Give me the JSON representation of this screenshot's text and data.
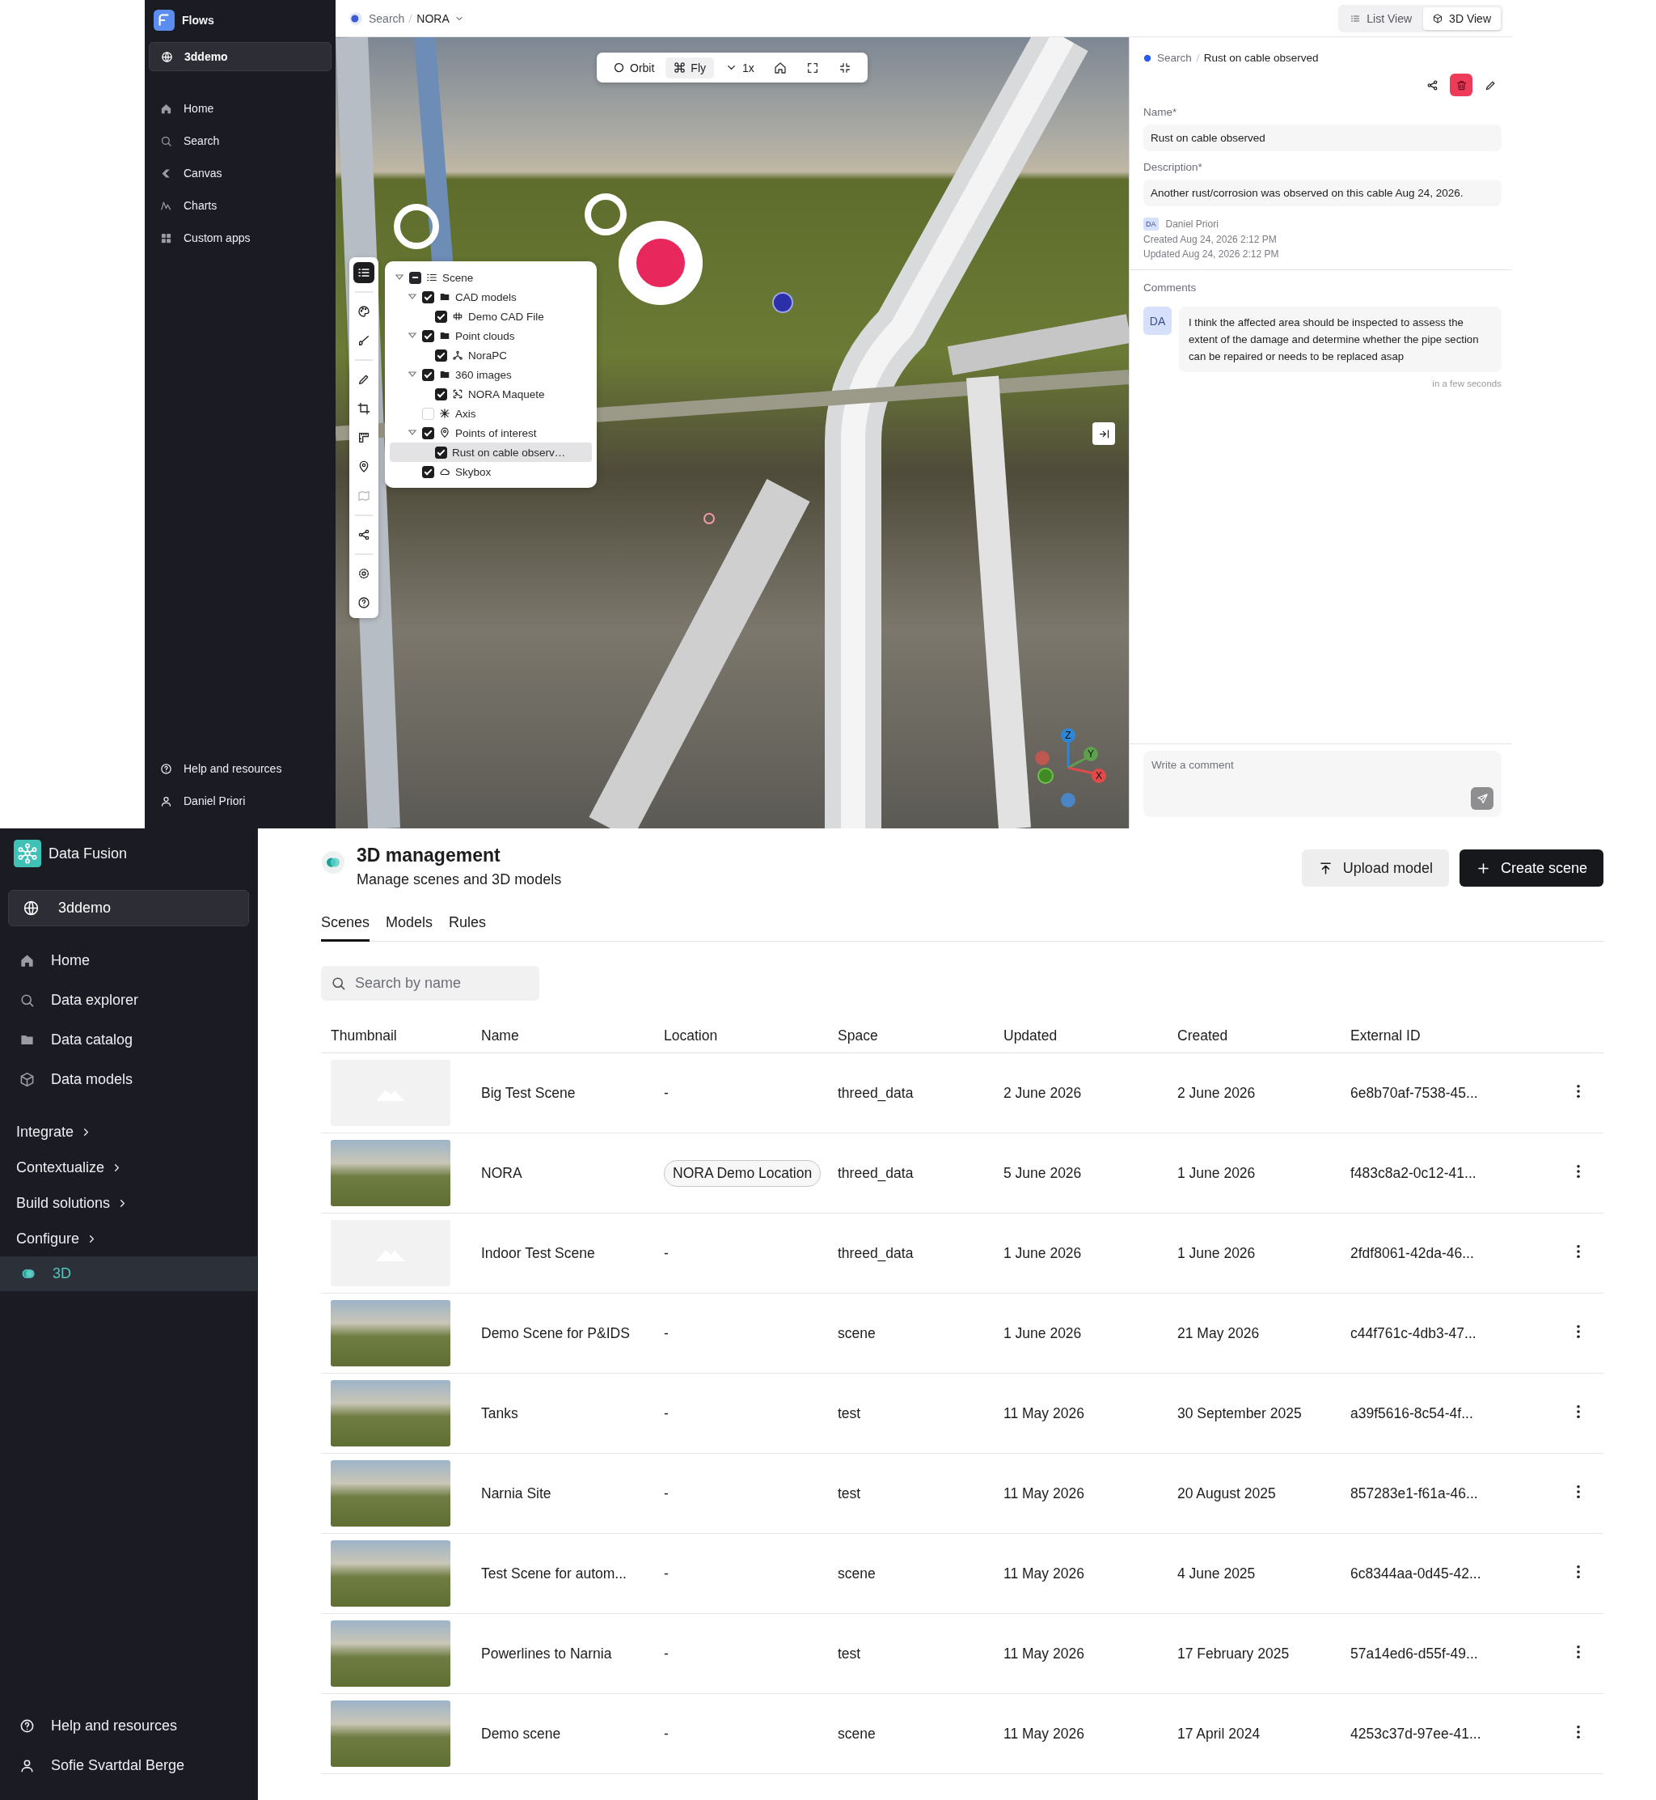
{
  "flows_app": {
    "sidebar": {
      "app_name": "Flows",
      "project": "3ddemo",
      "items": [
        {
          "label": "Home",
          "kind": "home"
        },
        {
          "label": "Search",
          "kind": "search"
        },
        {
          "label": "Canvas",
          "kind": "shape"
        },
        {
          "label": "Charts",
          "kind": "chart"
        },
        {
          "label": "Custom apps",
          "kind": "grid"
        }
      ],
      "footer": [
        {
          "label": "Help and resources",
          "kind": "help"
        },
        {
          "label": "Daniel Priori",
          "kind": "user"
        }
      ]
    },
    "header": {
      "breadcrumb": [
        "Search",
        "NORA"
      ],
      "views": [
        {
          "label": "List View",
          "kind": "list",
          "selected": false
        },
        {
          "label": "3D View",
          "kind": "cube",
          "selected": true
        }
      ]
    },
    "viewer": {
      "modes": [
        {
          "label": "Orbit",
          "kind": "circle",
          "selected": false
        },
        {
          "label": "Fly",
          "kind": "command",
          "selected": true
        }
      ],
      "speed": "1x",
      "tool_groups": [
        [
          {
            "kind": "list",
            "selected": true,
            "disabled": false
          }
        ],
        [
          {
            "kind": "palette",
            "selected": false,
            "disabled": false
          },
          {
            "kind": "brush",
            "selected": false,
            "disabled": false
          }
        ],
        [
          {
            "kind": "pencil",
            "selected": false,
            "disabled": false
          },
          {
            "kind": "crop",
            "selected": false,
            "disabled": false
          },
          {
            "kind": "ruler",
            "selected": false,
            "disabled": false
          },
          {
            "kind": "pin",
            "selected": false,
            "disabled": false
          },
          {
            "kind": "map",
            "selected": false,
            "disabled": true
          }
        ],
        [
          {
            "kind": "share",
            "selected": false,
            "disabled": false
          }
        ],
        [
          {
            "kind": "gear",
            "selected": false,
            "disabled": false
          },
          {
            "kind": "help",
            "selected": false,
            "disabled": false
          }
        ]
      ],
      "scene_tree": [
        {
          "label": "Scene",
          "kind": "list",
          "checked": false,
          "mixed": true,
          "selected": false,
          "expanded": true,
          "children": [
            {
              "label": "CAD models",
              "kind": "folder",
              "checked": true,
              "selected": false,
              "expanded": true,
              "children": [
                {
                  "label": "Demo CAD File",
                  "kind": "cad",
                  "checked": true,
                  "selected": false
                }
              ]
            },
            {
              "label": "Point clouds",
              "kind": "folder",
              "checked": true,
              "selected": false,
              "expanded": true,
              "children": [
                {
                  "label": "NoraPC",
                  "kind": "pointcloud",
                  "checked": true,
                  "selected": false
                }
              ]
            },
            {
              "label": "360 images",
              "kind": "folder",
              "checked": true,
              "selected": false,
              "expanded": true,
              "children": [
                {
                  "label": "NORA Maquete",
                  "kind": "image360",
                  "checked": true,
                  "selected": false
                }
              ]
            },
            {
              "label": "Axis",
              "kind": "axis",
              "checked": false,
              "selected": false
            },
            {
              "label": "Points of interest",
              "kind": "pin",
              "checked": true,
              "selected": false,
              "expanded": true,
              "children": [
                {
                  "label": "Rust on cable observ…",
                  "kind": "plain",
                  "checked": true,
                  "selected": true
                }
              ]
            },
            {
              "label": "Skybox",
              "kind": "cloud",
              "checked": true,
              "selected": false
            }
          ]
        }
      ],
      "axis_labels": [
        "Z",
        "Y",
        "X"
      ]
    },
    "detail_panel": {
      "breadcrumb": [
        "Search",
        "Rust on cable observed"
      ],
      "actions": [
        {
          "kind": "share"
        },
        {
          "kind": "delete"
        },
        {
          "kind": "edit"
        }
      ],
      "fields": [
        {
          "label": "Name*",
          "value": "Rust on cable observed"
        },
        {
          "label": "Description*",
          "value": "Another rust/corrosion was observed on this cable Aug 24, 2026."
        }
      ],
      "author": {
        "initials": "DA",
        "name": "Daniel Priori"
      },
      "created": "Created Aug 24, 2026 2:12 PM",
      "updated": "Updated Aug 24, 2026 2:12 PM",
      "comments_title": "Comments",
      "comments": [
        {
          "initials": "DA",
          "text": "I think the affected area should be inspected to assess the extent of the damage and determine whether the pipe section can be repaired or needs to be replaced asap",
          "time": "in a few seconds"
        }
      ],
      "comment_input": {
        "placeholder": "Write a comment"
      }
    }
  },
  "data_fusion_app": {
    "sidebar": {
      "app_name": "Data Fusion",
      "project": "3ddemo",
      "items": [
        {
          "label": "Home",
          "kind": "home"
        },
        {
          "label": "Data explorer",
          "kind": "search"
        },
        {
          "label": "Data catalog",
          "kind": "folder"
        },
        {
          "label": "Data models",
          "kind": "cube"
        }
      ],
      "nav": [
        {
          "label": "Integrate",
          "kind": "group",
          "selected": false
        },
        {
          "label": "Contextualize",
          "kind": "group",
          "selected": false
        },
        {
          "label": "Build solutions",
          "kind": "group",
          "selected": false
        },
        {
          "label": "Configure",
          "kind": "group",
          "selected": false
        },
        {
          "label": "3D",
          "kind": "link",
          "selected": true
        }
      ],
      "footer": [
        {
          "label": "Help and resources",
          "kind": "help"
        },
        {
          "label": "Sofie Svartdal Berge",
          "kind": "user"
        }
      ]
    },
    "page": {
      "title": "3D management",
      "subtitle": "Manage scenes and 3D models",
      "buttons": [
        {
          "label": "Upload model",
          "kind": "secondary"
        },
        {
          "label": "Create scene",
          "kind": "primary"
        }
      ],
      "tabs": [
        {
          "label": "Scenes",
          "selected": true
        },
        {
          "label": "Models",
          "selected": false
        },
        {
          "label": "Rules",
          "selected": false
        }
      ],
      "search": {
        "placeholder": "Search by name"
      },
      "table": {
        "columns": [
          "Thumbnail",
          "Name",
          "Location",
          "Space",
          "Updated",
          "Created",
          "External ID"
        ],
        "rows": [
          {
            "thumbnail": {
              "kind": "blank"
            },
            "name": "Big Test Scene",
            "location": {
              "text": "-",
              "kind": "plain"
            },
            "space": "threed_data",
            "updated": "2 June 2026",
            "created": "2 June 2026",
            "external_id": "6e8b70af-7538-45..."
          },
          {
            "thumbnail": {
              "kind": "photo"
            },
            "name": "NORA",
            "location": {
              "text": "NORA Demo Location",
              "kind": "chip"
            },
            "space": "threed_data",
            "updated": "5 June 2026",
            "created": "1 June 2026",
            "external_id": "f483c8a2-0c12-41..."
          },
          {
            "thumbnail": {
              "kind": "blank"
            },
            "name": "Indoor Test Scene",
            "location": {
              "text": "-",
              "kind": "plain"
            },
            "space": "threed_data",
            "updated": "1 June 2026",
            "created": "1 June 2026",
            "external_id": "2fdf8061-42da-46..."
          },
          {
            "thumbnail": {
              "kind": "photo"
            },
            "name": "Demo Scene for P&IDS",
            "location": {
              "text": "-",
              "kind": "plain"
            },
            "space": "scene",
            "updated": "1 June 2026",
            "created": "21 May 2026",
            "external_id": "c44f761c-4db3-47..."
          },
          {
            "thumbnail": {
              "kind": "photo"
            },
            "name": "Tanks",
            "location": {
              "text": "-",
              "kind": "plain"
            },
            "space": "test",
            "updated": "11 May 2026",
            "created": "30 September 2025",
            "external_id": "a39f5616-8c54-4f..."
          },
          {
            "thumbnail": {
              "kind": "photo"
            },
            "name": "Narnia Site",
            "location": {
              "text": "-",
              "kind": "plain"
            },
            "space": "test",
            "updated": "11 May 2026",
            "created": "20 August 2025",
            "external_id": "857283e1-f61a-46..."
          },
          {
            "thumbnail": {
              "kind": "photo"
            },
            "name": "Test Scene for autom...",
            "location": {
              "text": "-",
              "kind": "plain"
            },
            "space": "scene",
            "updated": "11 May 2026",
            "created": "4 June 2025",
            "external_id": "6c8344aa-0d45-42..."
          },
          {
            "thumbnail": {
              "kind": "photo"
            },
            "name": "Powerlines to Narnia",
            "location": {
              "text": "-",
              "kind": "plain"
            },
            "space": "test",
            "updated": "11 May 2026",
            "created": "17 February 2025",
            "external_id": "57a14ed6-d55f-49..."
          },
          {
            "thumbnail": {
              "kind": "photo"
            },
            "name": "Demo scene",
            "location": {
              "text": "-",
              "kind": "plain"
            },
            "space": "scene",
            "updated": "11 May 2026",
            "created": "17 April 2024",
            "external_id": "4253c37d-97ee-41..."
          }
        ]
      }
    }
  }
}
